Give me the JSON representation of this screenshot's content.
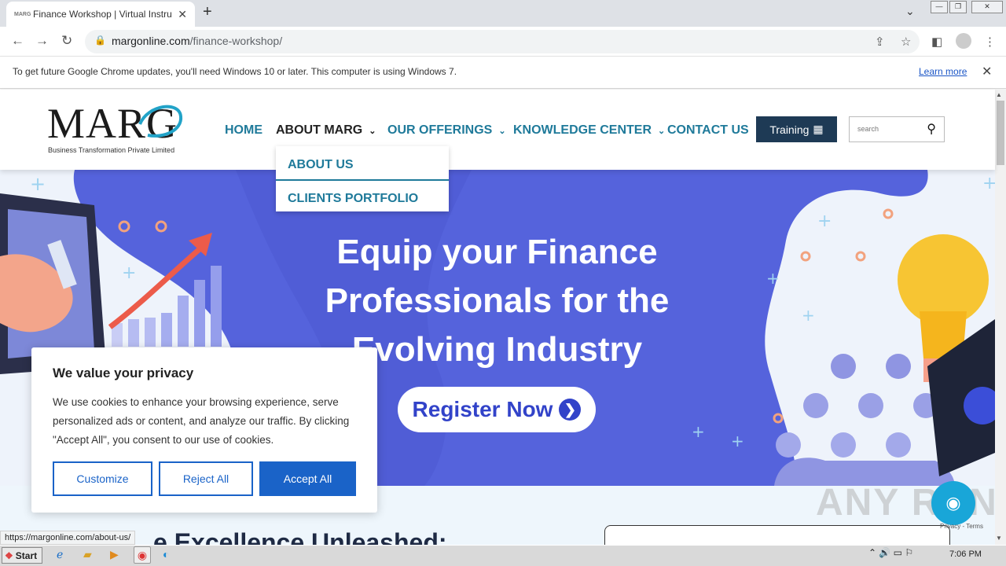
{
  "browser": {
    "tab_title": "Finance Workshop | Virtual Instructo",
    "tab_favicon": "MARG",
    "new_tab": "+",
    "url_host": "margonline.com",
    "url_path": "/finance-workshop/",
    "infobar_text": "To get future Google Chrome updates, you'll need Windows 10 or later. This computer is using Windows 7.",
    "infobar_link": "Learn more"
  },
  "site": {
    "logo_text": "MARG",
    "logo_subtitle": "Business Transformation Private Limited",
    "nav": {
      "home": "HOME",
      "about": "ABOUT MARG",
      "offerings": "OUR OFFERINGS",
      "knowledge": "KNOWLEDGE CENTER",
      "contact": "CONTACT US"
    },
    "dropdown": [
      "ABOUT US",
      "CLIENTS PORTFOLIO"
    ],
    "training_button": "Training",
    "search_placeholder": "search",
    "hero_title": "Equip your Finance Professionals for the Evolving Industry",
    "register_button": "Register Now",
    "section_heading": "e Excellence Unleashed:"
  },
  "cookie": {
    "title": "We value your privacy",
    "text": "We use cookies to enhance your browsing experience, serve personalized ads or content, and analyze our traffic. By clicking \"Accept All\", you consent to our use of cookies.",
    "customize": "Customize",
    "reject": "Reject All",
    "accept": "Accept All"
  },
  "status_url": "https://margonline.com/about-us/",
  "watermark": "ANY RUN",
  "recaptcha": "Privacy - Terms",
  "taskbar": {
    "start": "Start",
    "clock": "7:06 PM"
  },
  "colors": {
    "nav_teal": "#1f7a9a",
    "hero_blue": "#5160d8",
    "training_navy": "#1e3a55",
    "cookie_blue": "#1a63c8"
  }
}
